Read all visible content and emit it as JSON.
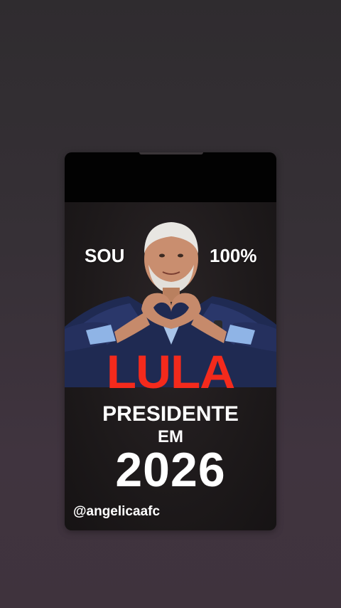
{
  "story_card": {
    "headline_left": "SOU",
    "headline_right": "100%",
    "name": "LULA",
    "line_one": "PRESIDENTE",
    "line_two": "EM",
    "year": "2026",
    "handle": "@angelicaafc"
  },
  "colors": {
    "accent_red": "#f42a1c",
    "text_white": "#ffffff",
    "card_top_bar": "#020202",
    "poster_bg": "#1e1a1b",
    "page_bg": "#363036"
  },
  "icons": {
    "photo": "portrait-heart-hands-photo"
  }
}
